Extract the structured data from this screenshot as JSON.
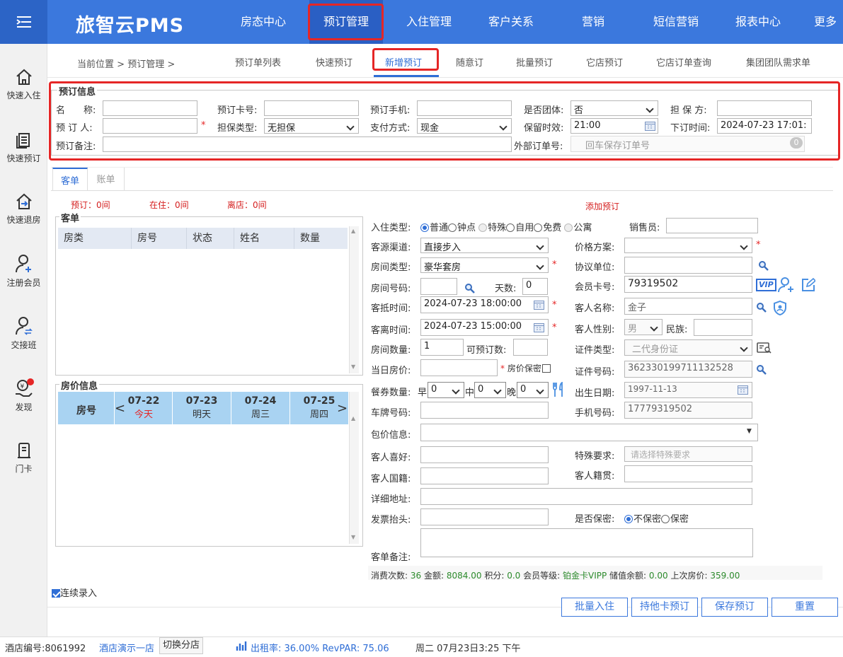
{
  "app": {
    "name": "旅智云PMS"
  },
  "nav": [
    "房态中心",
    "预订管理",
    "入住管理",
    "客户关系",
    "营销",
    "短信营销",
    "报表中心",
    "更多"
  ],
  "sidebar": [
    "快速入住",
    "快速预订",
    "快速退房",
    "注册会员",
    "交接班",
    "发现",
    "门卡"
  ],
  "breadcrumb": {
    "prefix": "当前位置",
    "sep": ">",
    "item": "预订管理",
    "end": ">"
  },
  "subnav": [
    "预订单列表",
    "快速预订",
    "新增预订",
    "随意订",
    "批量预订",
    "它店预订",
    "它店订单查询",
    "集团团队需求单"
  ],
  "booking": {
    "legend": "预订信息",
    "name_label": "名　　称:",
    "name": "",
    "card_label": "预订卡号:",
    "card": "",
    "phone_label": "预订手机:",
    "phone": "",
    "group_label": "是否团体:",
    "group": "否",
    "guarantor_label": "担 保 方:",
    "guarantor": "",
    "booker_label": "预 订 人:",
    "booker": "",
    "gtype_label": "担保类型:",
    "gtype": "无担保",
    "pay_label": "支付方式:",
    "pay": "现金",
    "hold_label": "保留时效:",
    "hold": "21:00",
    "time_label": "下订时间:",
    "time": "2024-07-23 17:01:",
    "remark_label": "预订备注:",
    "remark": "",
    "ext_label": "外部订单号:",
    "ext_placeholder": "回车保存订单号",
    "ext_count": "0",
    "required": "*"
  },
  "tabs": [
    "客单",
    "账单"
  ],
  "counts": {
    "booked": "预订：0间",
    "inhouse": "在住：0间",
    "leaving": "离店：0间"
  },
  "add_booking": "添加预订",
  "guest_list": {
    "legend": "客单",
    "cols": [
      "房类",
      "房号",
      "状态",
      "姓名",
      "数量"
    ]
  },
  "price": {
    "legend": "房价信息",
    "room_label": "房号",
    "days": [
      {
        "date": "07-22",
        "sub": "今天"
      },
      {
        "date": "07-23",
        "sub": "明天"
      },
      {
        "date": "07-24",
        "sub": "周三"
      },
      {
        "date": "07-25",
        "sub": "周四"
      }
    ]
  },
  "form": {
    "checkin_type_label": "入住类型:",
    "checkin_types": [
      "普通",
      "钟点",
      "特殊",
      "自用",
      "免费",
      "公寓"
    ],
    "sales_label": "销售员:",
    "sales": "",
    "channel_label": "客源渠道:",
    "channel": "直接步入",
    "plan_label": "价格方案:",
    "plan": "",
    "roomtype_label": "房间类型:",
    "roomtype": "豪华套房",
    "agreement_label": "协议单位:",
    "agreement": "",
    "roomno_label": "房间号码:",
    "roomno": "",
    "days_label": "天数:",
    "days": "0",
    "member_label": "会员卡号:",
    "member": "79319502",
    "vip": "VIP",
    "arrive_label": "客抵时间:",
    "arrive": "2024-07-23 18:00:00",
    "guest_label": "客人名称:",
    "guest": "金子",
    "depart_label": "客离时间:",
    "depart": "2024-07-23 15:00:00",
    "gender_label": "客人性别:",
    "gender": "男",
    "ethnic_label": "民族:",
    "ethnic": "",
    "count_label": "房间数量:",
    "count": "1",
    "avail_label": "可预订数:",
    "avail": "",
    "idtype_label": "证件类型:",
    "idtype": "二代身份证",
    "dayprice_label": "当日房价:",
    "dayprice": "",
    "secret_price_label": "房价保密",
    "idno_label": "证件号码:",
    "idno": "362330199711132528",
    "meal_label": "餐券数量:",
    "breakfast_label": "早",
    "breakfast": "0",
    "lunch_label": "中",
    "lunch": "0",
    "dinner_label": "晚",
    "dinner": "0",
    "birth_label": "出生日期:",
    "birth": "1997-11-13",
    "plate_label": "车牌号码:",
    "plate": "",
    "mobile_label": "手机号码:",
    "mobile": "17779319502",
    "package_label": "包价信息:",
    "package": "",
    "pref_label": "客人喜好:",
    "pref": "",
    "special_label": "特殊要求:",
    "special_placeholder": "请选择特殊要求",
    "nation_label": "客人国籍:",
    "nation": "",
    "origin_label": "客人籍贯:",
    "origin": "",
    "address_label": "详细地址:",
    "address": "",
    "invoice_label": "发票抬头:",
    "invoice": "",
    "secret_label": "是否保密:",
    "secret_no": "不保密",
    "secret_yes": "保密",
    "note_label": "客单备注:",
    "note": ""
  },
  "summary": {
    "visits_label": "消费次数:",
    "visits": "36",
    "amount_label": "金额:",
    "amount": "8084.00",
    "points_label": "积分:",
    "points": "0.0",
    "level_label": "会员等级:",
    "level": "铂金卡VIPP",
    "balance_label": "储值余额:",
    "balance": "0.00",
    "last_label": "上次房价:",
    "last": "359.00"
  },
  "continuous": "连续录入",
  "buttons": [
    "批量入住",
    "持他卡预订",
    "保存预订",
    "重置"
  ],
  "status": {
    "hotel_label": "酒店编号:",
    "hotel_no": "8061992",
    "hotel_name": "酒店演示一店",
    "switch": "切换分店",
    "occupancy": "出租率: 36.00% RevPAR: 75.06",
    "datetime": "周二 07月23日3:25 下午"
  },
  "colors": {
    "primary": "#3b78dd",
    "highlight": "#e52626",
    "header": "#a9d3f2"
  }
}
